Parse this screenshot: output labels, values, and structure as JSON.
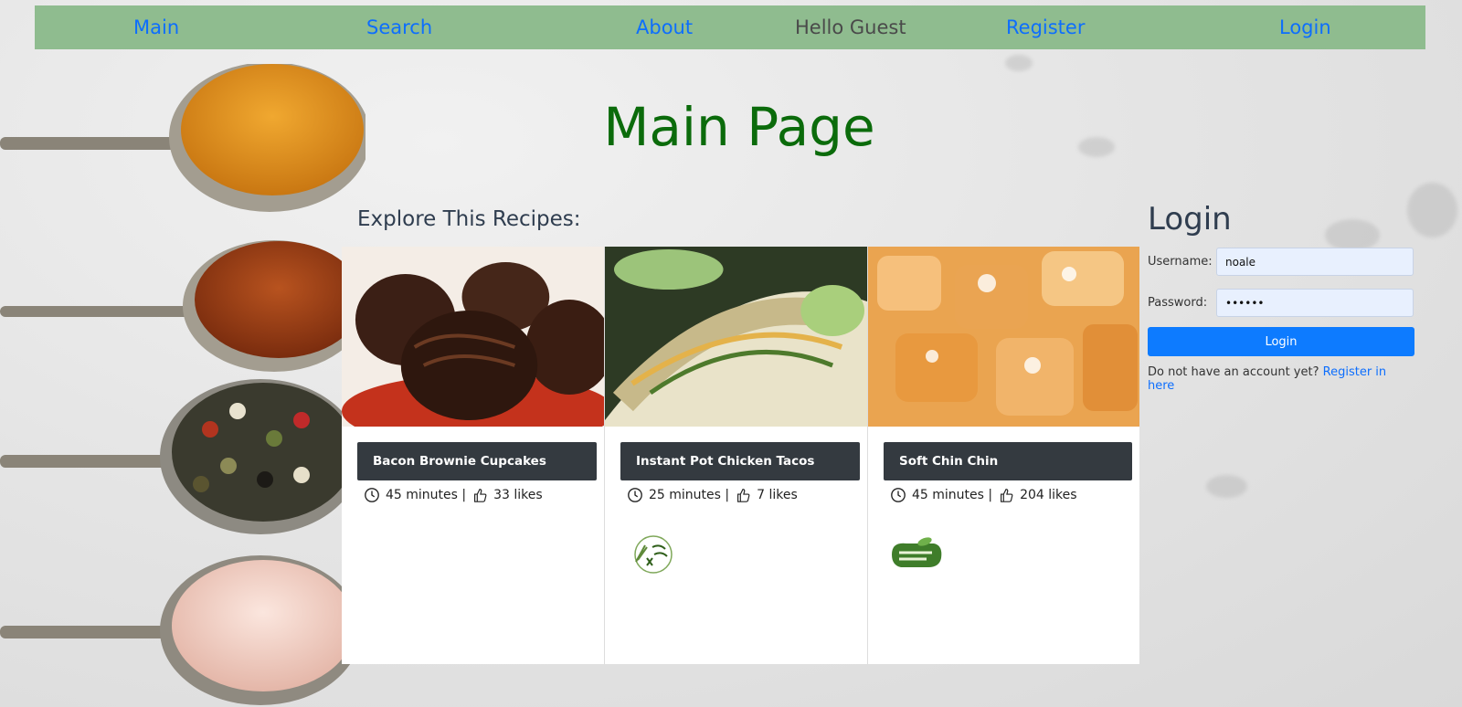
{
  "nav": {
    "items": [
      "Main",
      "Search",
      "About",
      "Register",
      "Login"
    ],
    "greeting": "Hello Guest"
  },
  "page_title": "Main Page",
  "section_title": "Explore This Recipes:",
  "recipes": [
    {
      "title": "Bacon Brownie Cupcakes",
      "time": "45 minutes |",
      "likes": "33 likes",
      "badge": null
    },
    {
      "title": "Instant Pot Chicken Tacos",
      "time": "25 minutes |",
      "likes": "7 likes",
      "badge": "gluten-free"
    },
    {
      "title": "Soft Chin Chin",
      "time": "45 minutes |",
      "likes": "204 likes",
      "badge": "100% vegetarian"
    }
  ],
  "login": {
    "title": "Login",
    "username_label": "Username:",
    "username_value": "noale",
    "password_label": "Password:",
    "password_value": "••••••",
    "button_label": "Login",
    "register_prompt": "Do not have an account yet?",
    "register_link": "Register in here"
  },
  "colors": {
    "nav_bg": "#8fbc8f",
    "link": "#0d6efd",
    "title_green": "#0b6b0b",
    "card_title_bg": "#343a40",
    "button": "#0d7bff"
  }
}
